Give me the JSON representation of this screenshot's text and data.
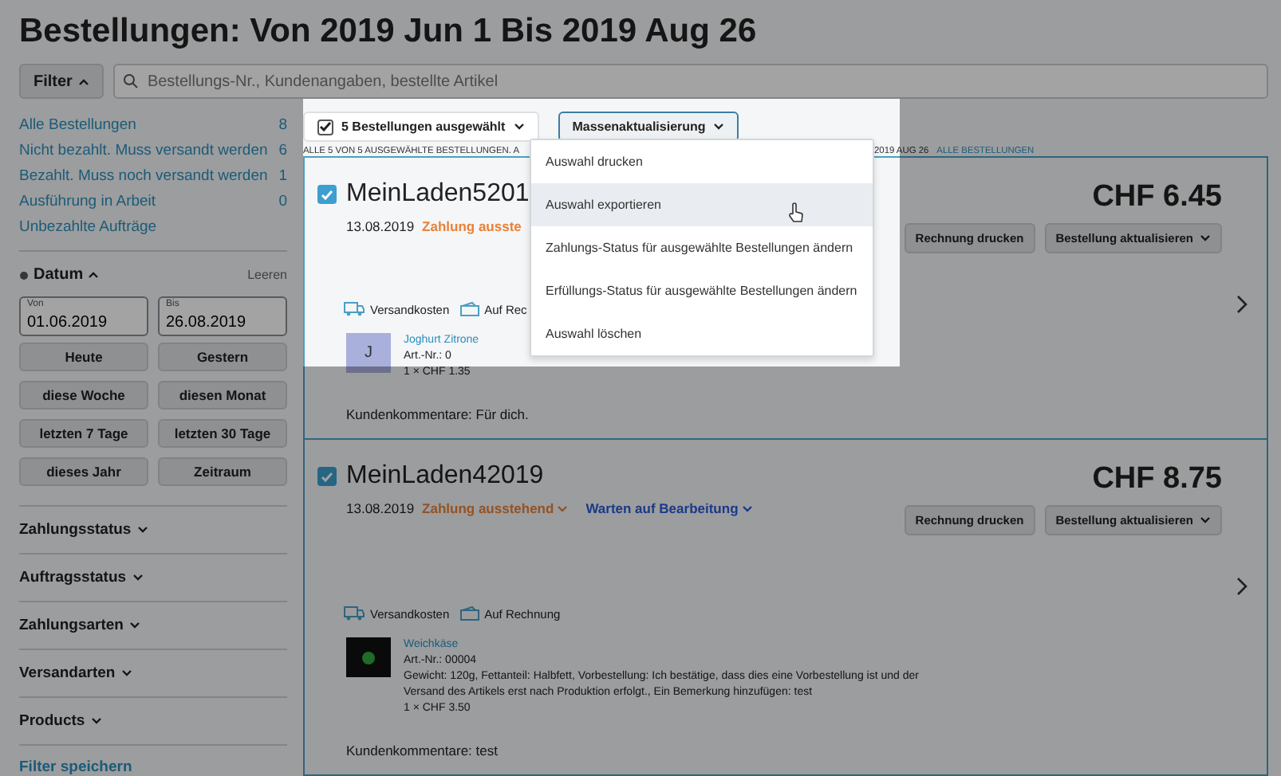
{
  "title": "Bestellungen: Von 2019 Jun 1 Bis 2019 Aug 26",
  "filter_button": {
    "label": "Filter",
    "expanded": true
  },
  "search": {
    "placeholder": "Bestellungs-Nr., Kundenangaben, bestellte Artikel"
  },
  "sidebar": {
    "views": [
      {
        "label": "Alle Bestellungen",
        "count": "8"
      },
      {
        "label": "Nicht bezahlt. Muss versandt werden",
        "count": "6"
      },
      {
        "label": "Bezahlt. Muss noch versandt werden",
        "count": "1"
      },
      {
        "label": "Ausführung in Arbeit",
        "count": "0"
      },
      {
        "label": "Unbezahlte Aufträge"
      }
    ],
    "date_filter": {
      "label": "Datum",
      "expanded": true,
      "clear": "Leeren",
      "fields": [
        {
          "label": "Von",
          "value": "01.06.2019"
        },
        {
          "label": "Bis",
          "value": "26.08.2019"
        }
      ],
      "presets": [
        "Heute",
        "Gestern",
        "diese Woche",
        "diesen Monat",
        "letzten 7 Tage",
        "letzten 30 Tage",
        "dieses Jahr",
        "Zeitraum"
      ]
    },
    "sections": [
      {
        "label": "Zahlungsstatus",
        "expanded": false
      },
      {
        "label": "Auftragsstatus",
        "expanded": false
      },
      {
        "label": "Zahlungsarten",
        "expanded": false
      },
      {
        "label": "Versandarten",
        "expanded": false
      },
      {
        "label": "Products",
        "expanded": false
      }
    ],
    "save_filter": "Filter speichern"
  },
  "toolbar": {
    "selection": {
      "label": "5 Bestellungen ausgewählt",
      "checked": true
    },
    "bulk_button": "Massenaktualisierung"
  },
  "notice": {
    "text": "ALLE 5 VON 5 AUSGEWÄHLTE BESTELLUNGEN. A",
    "range": "2019 AUG 26",
    "link": "ALLE BESTELLUNGEN"
  },
  "bulk_menu": [
    {
      "label": "Auswahl drucken",
      "highlighted": false
    },
    {
      "label": "Auswahl exportieren",
      "highlighted": true
    },
    {
      "label": "Zahlungs-Status für ausgewählte Bestellungen ändern",
      "highlighted": false
    },
    {
      "label": "Erfüllungs-Status für ausgewählte Bestellungen ändern",
      "highlighted": false
    },
    {
      "label": "Auswahl löschen",
      "highlighted": false
    }
  ],
  "orders": [
    {
      "number": "MeinLaden5201",
      "selected": true,
      "date": "13.08.2019",
      "statuses": [
        {
          "label": "Zahlung ausste",
          "kind": "payment"
        }
      ],
      "total": "CHF 6.45",
      "print_button": "Rechnung drucken",
      "update_button": "Bestellung aktualisieren",
      "shipping": "Versandkosten",
      "payment": "Auf Rec",
      "items": [
        {
          "kind": "letter",
          "letter": "J",
          "name": "Joghurt Zitrone",
          "sku": "Art.-Nr.: 0",
          "price": "1 × CHF 1.35"
        }
      ],
      "comment": "Kundenkommentare: Für dich."
    },
    {
      "number": "MeinLaden42019",
      "selected": true,
      "date": "13.08.2019",
      "statuses": [
        {
          "label": "Zahlung ausstehend",
          "kind": "payment"
        },
        {
          "label": "Warten auf Bearbeitung",
          "kind": "fulfillment"
        }
      ],
      "total": "CHF 8.75",
      "print_button": "Rechnung drucken",
      "update_button": "Bestellung aktualisieren",
      "shipping": "Versandkosten",
      "payment": "Auf Rechnung",
      "items": [
        {
          "kind": "photo",
          "name": "Weichkäse",
          "sku": "Art.-Nr.: 00004",
          "details": "Gewicht: 120g, Fettanteil: Halbfett, Vorbestellung: Ich bestätige, dass dies eine Vorbestellung ist und der Versand des Artikels erst nach Produktion erfolgt., Ein Bemerkung hinzufügen: test",
          "price": "1 × CHF 3.50"
        }
      ],
      "comment": "Kundenkommentare: test"
    }
  ]
}
